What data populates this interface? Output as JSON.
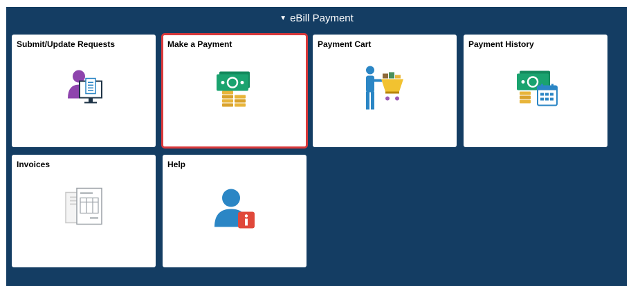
{
  "header": {
    "title": "eBill Payment",
    "collapse_icon": "caret-down-icon"
  },
  "tiles": [
    {
      "title": "Submit/Update Requests",
      "icon": "user-document-monitor-icon"
    },
    {
      "title": "Make a Payment",
      "icon": "money-coins-icon",
      "selected": true
    },
    {
      "title": "Payment Cart",
      "icon": "shopping-cart-person-icon"
    },
    {
      "title": "Payment History",
      "icon": "money-calendar-icon"
    },
    {
      "title": "Invoices",
      "icon": "documents-icon"
    },
    {
      "title": "Help",
      "icon": "user-info-icon"
    }
  ],
  "colors": {
    "panel_bg": "#143d63",
    "selected_border": "#d9383a",
    "money_green": "#1aa36f",
    "coin_gold": "#e8b53a",
    "info_red": "#e0483a",
    "person_blue": "#2b86c5",
    "person_purple": "#8e44ad"
  }
}
